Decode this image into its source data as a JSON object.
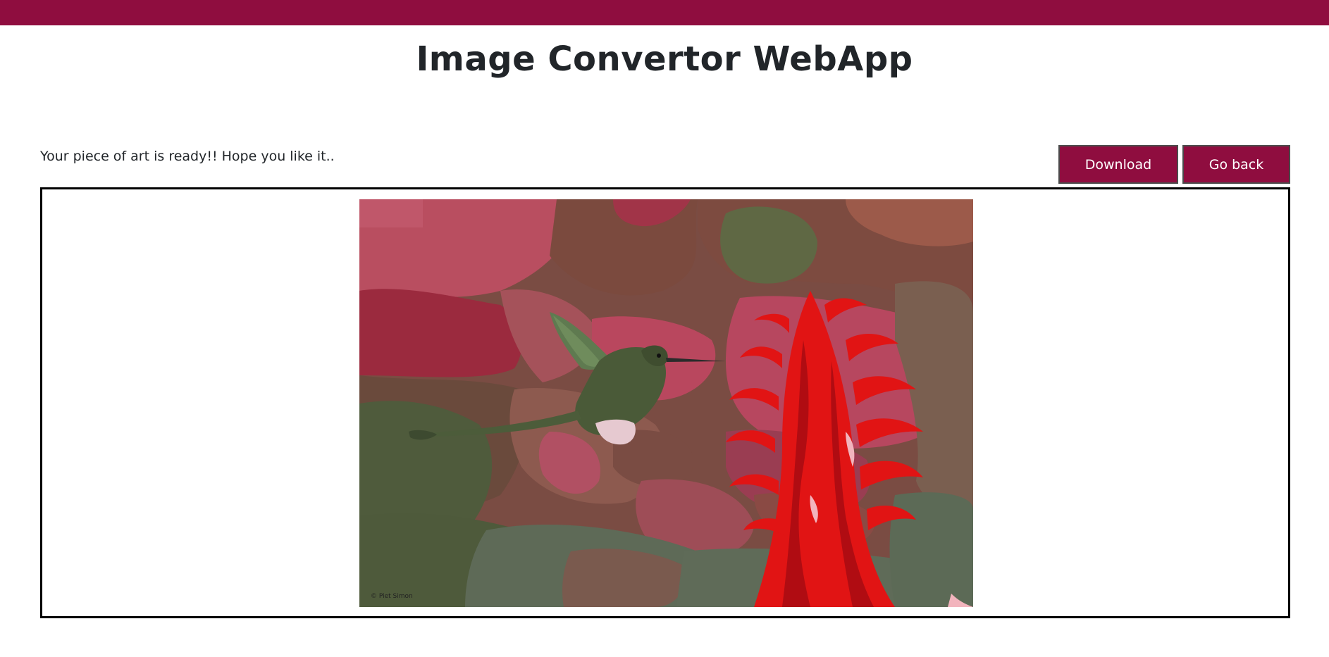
{
  "header": {
    "title": "Image Convertor WebApp",
    "bar_color": "#8f0d3f"
  },
  "result": {
    "message": "Your piece of art is ready!! Hope you like it..",
    "image_credit": "© Piet Simon"
  },
  "actions": {
    "download_label": "Download",
    "back_label": "Go back"
  },
  "theme": {
    "accent": "#8f0d3f",
    "text": "#212529",
    "frame_border": "#000000"
  },
  "image": {
    "subject": "posterized hummingbird hovering beside a red bromeliad flower"
  }
}
